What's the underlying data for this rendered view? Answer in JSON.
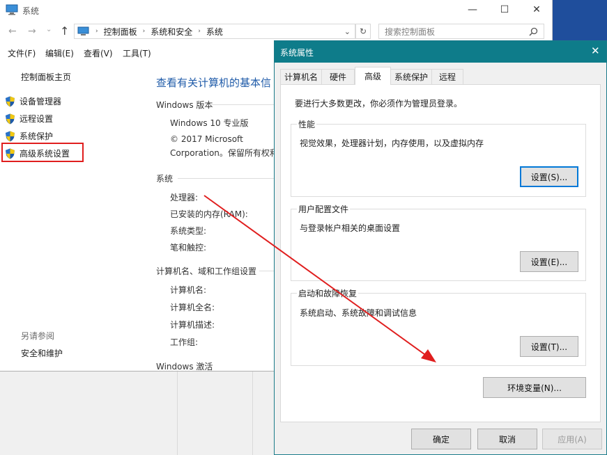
{
  "window": {
    "title": "系统",
    "menu": [
      "文件(F)",
      "编辑(E)",
      "查看(V)",
      "工具(T)"
    ],
    "breadcrumb": [
      "控制面板",
      "系统和安全",
      "系统"
    ],
    "search_placeholder": "搜索控制面板"
  },
  "sidebar": {
    "home": "控制面板主页",
    "items": [
      {
        "label": "设备管理器"
      },
      {
        "label": "远程设置"
      },
      {
        "label": "系统保护"
      },
      {
        "label": "高级系统设置"
      }
    ],
    "see_also_title": "另请参阅",
    "see_also_link": "安全和维护"
  },
  "main": {
    "heading": "查看有关计算机的基本信",
    "windows_edition_title": "Windows 版本",
    "edition": "Windows 10 专业版",
    "copyright_line1": "© 2017 Microsoft",
    "copyright_line2": "Corporation。保留所有权利",
    "system_title": "系统",
    "system_fields": [
      "处理器:",
      "已安装的内存(RAM):",
      "系统类型:",
      "笔和触控:"
    ],
    "computer_title": "计算机名、域和工作组设置",
    "computer_fields": [
      "计算机名:",
      "计算机全名:",
      "计算机描述:",
      "工作组:"
    ],
    "activation_title": "Windows 激活"
  },
  "dialog": {
    "title": "系统属性",
    "tabs": [
      "计算机名",
      "硬件",
      "高级",
      "系统保护",
      "远程"
    ],
    "admin_note": "要进行大多数更改，你必须作为管理员登录。",
    "performance": {
      "label": "性能",
      "desc": "视觉效果，处理器计划，内存使用，以及虚拟内存",
      "button": "设置(S)..."
    },
    "user_profiles": {
      "label": "用户配置文件",
      "desc": "与登录帐户相关的桌面设置",
      "button": "设置(E)..."
    },
    "startup_recovery": {
      "label": "启动和故障恢复",
      "desc": "系统启动、系统故障和调试信息",
      "button": "设置(T)..."
    },
    "env_button": "环境变量(N)...",
    "ok": "确定",
    "cancel": "取消",
    "apply": "应用(A)"
  },
  "colors": {
    "dialog_title_bg": "#0e7c8a",
    "highlight_box": "#e01e1e",
    "arrow": "#e01e1e",
    "link_heading": "#1e5aa8"
  }
}
